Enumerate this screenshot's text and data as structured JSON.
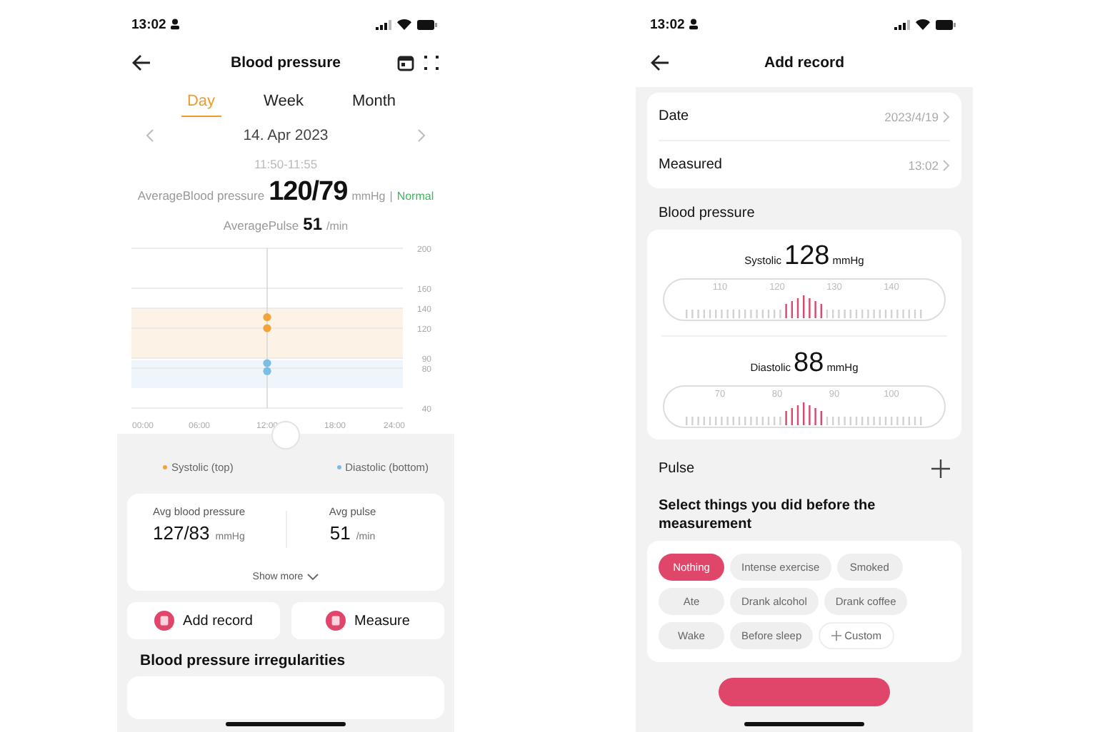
{
  "left_screen": {
    "status_bar": {
      "time": "13:02"
    },
    "title": "Blood pressure",
    "tabs": [
      {
        "label": "Day",
        "selected": true
      },
      {
        "label": "Week",
        "selected": false
      },
      {
        "label": "Month",
        "selected": false
      }
    ],
    "date": "14. Apr 2023",
    "time_range": "11:50-11:55",
    "average_bp": {
      "label": "AverageBlood pressure",
      "value": "120/79",
      "unit": "mmHg",
      "separator": "|",
      "status": "Normal"
    },
    "average_pulse": {
      "label": "AveragePulse",
      "value": "51",
      "unit": "/min"
    },
    "chart_data": {
      "type": "scatter",
      "x": [
        12,
        12
      ],
      "xlim": [
        0,
        24
      ],
      "ylim": [
        40,
        200
      ],
      "series": [
        {
          "name": "Systolic (top)",
          "color": "#f2a33a",
          "values": [
            131,
            120
          ]
        },
        {
          "name": "Diastolic (bottom)",
          "color": "#7cbde3",
          "values": [
            85,
            77
          ]
        }
      ],
      "xticks": [
        {
          "value": 0,
          "label": "00:00"
        },
        {
          "value": 6,
          "label": "06:00"
        },
        {
          "value": 12,
          "label": "12:00"
        },
        {
          "value": 18,
          "label": "18:00"
        },
        {
          "value": 24,
          "label": "24:00"
        }
      ],
      "yticks": [
        40,
        80,
        90,
        120,
        140,
        160,
        200
      ],
      "grid": true,
      "bands": [
        {
          "axis": "y",
          "from": 90,
          "to": 140,
          "color": "#fdf2e6"
        },
        {
          "axis": "y",
          "from": 60,
          "to": 88,
          "color": "#eef5fb"
        }
      ],
      "ref_lines": [
        {
          "axis": "x",
          "value": 12,
          "color": "#d8d8d8"
        }
      ]
    },
    "summary": {
      "bp_label": "Avg blood pressure",
      "bp_value": "127/83",
      "bp_unit": "mmHg",
      "pulse_label": "Avg pulse",
      "pulse_value": "51",
      "pulse_unit": "/min",
      "show_more": "Show more"
    },
    "buttons": [
      "Add record",
      "Measure"
    ],
    "section_title": "Blood pressure irregularities"
  },
  "right_screen": {
    "status_bar": {
      "time": "13:02"
    },
    "title": "Add record",
    "rows": [
      {
        "label": "Date",
        "value": "2023/4/19"
      },
      {
        "label": "Measured",
        "value": "13:02"
      }
    ],
    "section_title": "Blood pressure",
    "dials": [
      {
        "label": "Systolic",
        "value": "128",
        "unit": "mmHg",
        "ticks": [
          "110",
          "120",
          "130",
          "140"
        ]
      },
      {
        "label": "Diastolic",
        "value": "88",
        "unit": "mmHg",
        "ticks": [
          "70",
          "80",
          "90",
          "100"
        ]
      }
    ],
    "pulse_label": "Pulse",
    "question": "Select things you did before the measurement",
    "chips": [
      {
        "label": "Nothing",
        "selected": true,
        "kind": "tag"
      },
      {
        "label": "Intense exercise",
        "selected": false,
        "kind": "tag"
      },
      {
        "label": "Smoked",
        "selected": false,
        "kind": "tag"
      },
      {
        "label": "Ate",
        "selected": false,
        "kind": "tag"
      },
      {
        "label": "Drank alcohol",
        "selected": false,
        "kind": "tag"
      },
      {
        "label": "Drank coffee",
        "selected": false,
        "kind": "tag"
      },
      {
        "label": "Wake",
        "selected": false,
        "kind": "tag"
      },
      {
        "label": "Before sleep",
        "selected": false,
        "kind": "tag"
      },
      {
        "label": "Custom",
        "selected": false,
        "kind": "add"
      }
    ]
  }
}
